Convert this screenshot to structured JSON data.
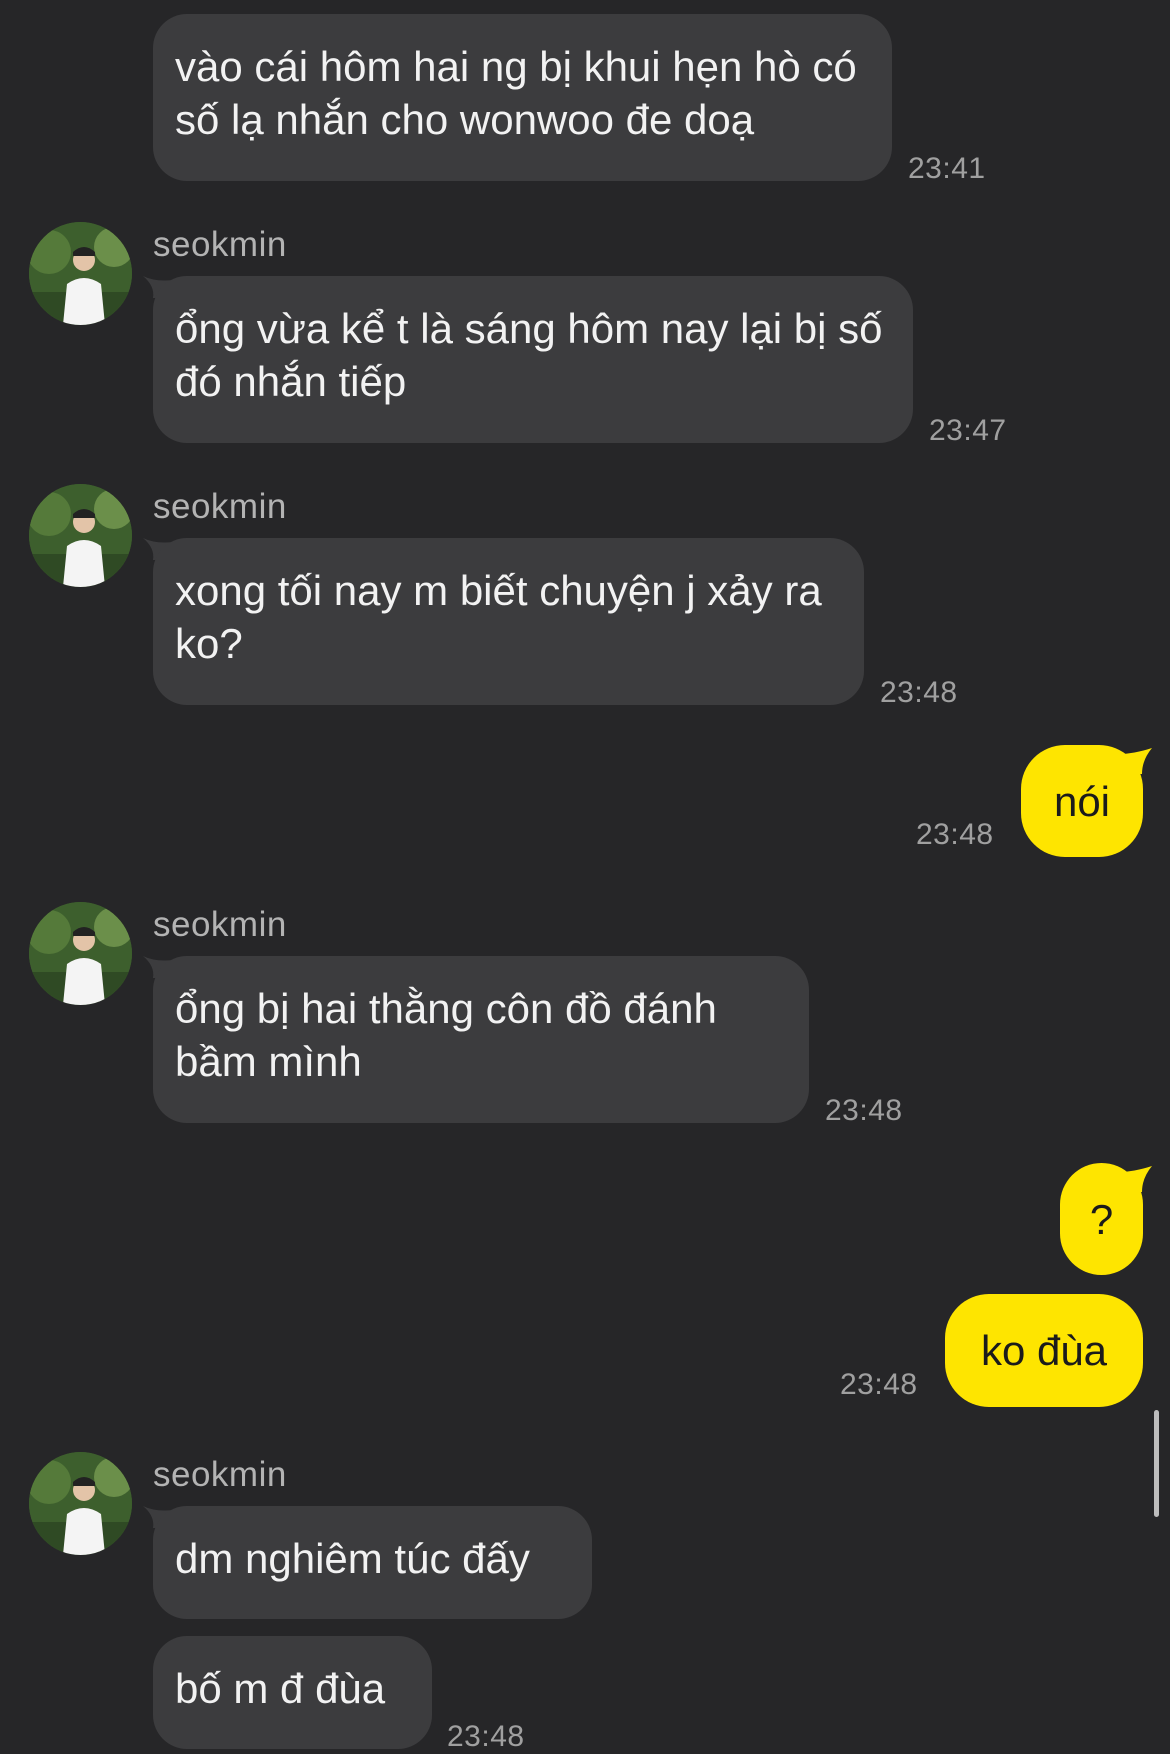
{
  "chat": {
    "partner_name": "seokmin",
    "messages": [
      {
        "text": "vào cái hôm hai ng bị khui hẹn hò có số lạ nhắn cho wonwoo đe doạ",
        "time": "23:41"
      },
      {
        "text": "ổng vừa kể t là sáng hôm nay lại bị số đó nhắn tiếp",
        "time": "23:47"
      },
      {
        "text": "xong tối nay m biết chuyện j xảy ra ko?",
        "time": "23:48"
      },
      {
        "text": "nói",
        "time": "23:48",
        "from_me": true
      },
      {
        "text": "ổng bị hai thằng côn đồ đánh bầm mình",
        "time": "23:48"
      },
      {
        "text": "?",
        "from_me": true
      },
      {
        "text": "ko đùa",
        "time": "23:48",
        "from_me": true
      },
      {
        "text": "dm nghiêm túc đấy"
      },
      {
        "text": "bố m đ đùa",
        "time": "23:48"
      }
    ]
  },
  "colors": {
    "background": "#262628",
    "incoming_bubble": "#3c3c3e",
    "outgoing_bubble": "#fee500"
  },
  "icons": {
    "avatar": "profile-photo"
  }
}
